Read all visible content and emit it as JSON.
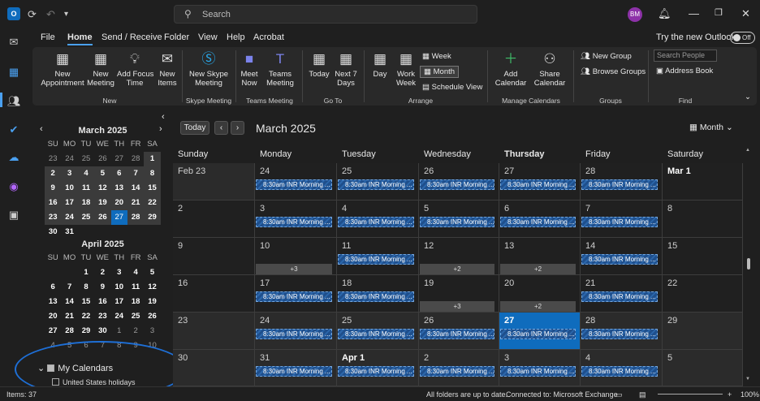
{
  "titlebar": {
    "search_placeholder": "Search",
    "avatar_initials": "BM"
  },
  "menu": {
    "file": "File",
    "home": "Home",
    "send_receive": "Send / Receive",
    "folder": "Folder",
    "view": "View",
    "help": "Help",
    "acrobat": "Acrobat",
    "try_new": "Try the new Outlook",
    "toggle": "Off"
  },
  "ribbon": {
    "new_appt": "New\nAppointment",
    "new_meeting": "New\nMeeting",
    "focus": "Add Focus\nTime",
    "new_items": "New\nItems",
    "grp_new": "New",
    "skype": "New Skype\nMeeting",
    "grp_skype": "Skype Meeting",
    "meet_now": "Meet\nNow",
    "teams": "Teams\nMeeting",
    "grp_teams": "Teams Meeting",
    "today": "Today",
    "next7": "Next 7\nDays",
    "grp_goto": "Go To",
    "day": "Day",
    "workweek": "Work\nWeek",
    "week": "Week",
    "month": "Month",
    "schedule": "Schedule View",
    "grp_arrange": "Arrange",
    "add_cal": "Add\nCalendar",
    "share_cal": "Share\nCalendar",
    "grp_manage": "Manage Calendars",
    "new_group": "New Group",
    "browse_groups": "Browse Groups",
    "grp_groups": "Groups",
    "search_people": "Search People",
    "address_book": "Address Book",
    "grp_find": "Find"
  },
  "nav": {
    "march": {
      "title": "March 2025",
      "dows": [
        "SU",
        "MO",
        "TU",
        "WE",
        "TH",
        "FR",
        "SA"
      ],
      "rows": [
        [
          "23",
          "24",
          "25",
          "26",
          "27",
          "28",
          "1"
        ],
        [
          "2",
          "3",
          "4",
          "5",
          "6",
          "7",
          "8"
        ],
        [
          "9",
          "10",
          "11",
          "12",
          "13",
          "14",
          "15"
        ],
        [
          "16",
          "17",
          "18",
          "19",
          "20",
          "21",
          "22"
        ],
        [
          "23",
          "24",
          "25",
          "26",
          "27",
          "28",
          "29"
        ],
        [
          "30",
          "31",
          "",
          "",
          "",
          "",
          ""
        ]
      ]
    },
    "april": {
      "title": "April 2025",
      "dows": [
        "SU",
        "MO",
        "TU",
        "WE",
        "TH",
        "FR",
        "SA"
      ],
      "rows": [
        [
          "",
          "",
          "1",
          "2",
          "3",
          "4",
          "5"
        ],
        [
          "6",
          "7",
          "8",
          "9",
          "10",
          "11",
          "12"
        ],
        [
          "13",
          "14",
          "15",
          "16",
          "17",
          "18",
          "19"
        ],
        [
          "20",
          "21",
          "22",
          "23",
          "24",
          "25",
          "26"
        ],
        [
          "27",
          "28",
          "29",
          "30",
          "1",
          "2",
          "3"
        ],
        [
          "4",
          "5",
          "6",
          "7",
          "8",
          "9",
          "10"
        ]
      ]
    },
    "my_calendars": "My Calendars",
    "us_holidays": "United States holidays"
  },
  "calendar": {
    "today_btn": "Today",
    "title": "March 2025",
    "view": "Month",
    "dows": [
      "Sunday",
      "Monday",
      "Tuesday",
      "Wednesday",
      "Thursday",
      "Friday",
      "Saturday"
    ],
    "weeks": [
      [
        "Feb 23",
        "24",
        "25",
        "26",
        "27",
        "28",
        "Mar 1"
      ],
      [
        "2",
        "3",
        "4",
        "5",
        "6",
        "7",
        "8"
      ],
      [
        "9",
        "10",
        "11",
        "12",
        "13",
        "14",
        "15"
      ],
      [
        "16",
        "17",
        "18",
        "19",
        "20",
        "21",
        "22"
      ],
      [
        "23",
        "24",
        "25",
        "26",
        "27",
        "28",
        "29"
      ],
      [
        "30",
        "31",
        "Apr 1",
        "2",
        "3",
        "4",
        "5"
      ]
    ],
    "event_label": "8:30am INR Morning ...",
    "more_labels": {
      "w2_mon": "+3",
      "w2_wed": "+2",
      "w2_thu": "+2",
      "w3_wed": "+3",
      "w3_thu": "+2"
    }
  },
  "status": {
    "items": "Items: 37",
    "folders": "All folders are up to date.",
    "connected": "Connected to: Microsoft Exchange",
    "zoom": "100%"
  }
}
